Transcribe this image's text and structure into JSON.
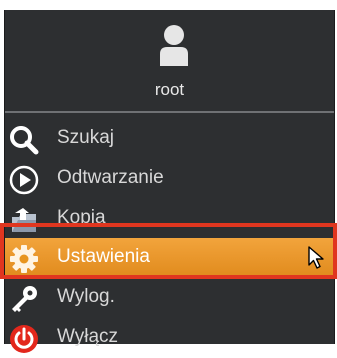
{
  "user": {
    "name": "root",
    "avatar_icon": "user-icon"
  },
  "menu": {
    "items": [
      {
        "label": "Szukaj",
        "icon": "search-icon"
      },
      {
        "label": "Odtwarzanie",
        "icon": "play-icon"
      },
      {
        "label": "Kopia",
        "icon": "backup-icon"
      },
      {
        "label": "Ustawienia",
        "icon": "settings-gear-icon",
        "selected": true
      },
      {
        "label": "Wylog.",
        "icon": "logout-key-icon"
      },
      {
        "label": "Wyłącz",
        "icon": "power-icon"
      }
    ]
  },
  "colors": {
    "panel_background": "#2d2f31",
    "selected_background": "#e8951f",
    "highlight_frame": "#e0361f",
    "text": "#d8d8d8"
  },
  "cursor_icon": "mouse-pointer-icon"
}
